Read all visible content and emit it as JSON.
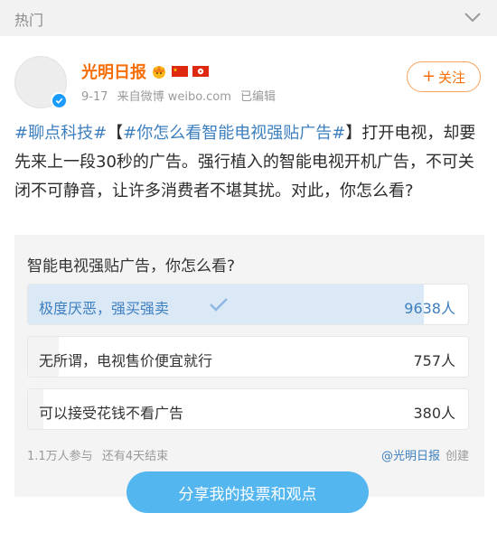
{
  "topbar": {
    "title": "热门"
  },
  "post": {
    "author": "光明日报",
    "date": "9-17",
    "source": "来自微博 weibo.com",
    "edited": "已编辑",
    "follow_label": "关注",
    "text_parts": [
      "#聊点科技#",
      "【",
      "#你怎么看智能电视强贴广告#",
      "】打开电视，却要先来上一段30秒的广告。强行植入的智能电视开机广告，不可关闭不可静音，让许多消费者不堪其扰。对此，你怎么看?"
    ]
  },
  "vote": {
    "question": "智能电视强贴广告，你怎么看?",
    "options": [
      {
        "label": "极度厌恶，强买强卖",
        "count": "9638人",
        "share": 0.8984,
        "selected": true
      },
      {
        "label": "无所谓，电视售价便宜就行",
        "count": "757人",
        "share": 0.0706,
        "selected": false
      },
      {
        "label": "可以接受花钱不看广告",
        "count": "380人",
        "share": 0.0354,
        "selected": false
      }
    ],
    "participants": "1.1万人参与",
    "remaining": "还有4天结束",
    "creator": "@光明日报",
    "created": "创建",
    "share_button": "分享我的投票和观点"
  },
  "colors": {
    "accent_orange": "#f86e06",
    "link_blue": "#3d7fbf",
    "button_blue": "#54b6ef",
    "selected_fill": "#dbe9f7"
  }
}
